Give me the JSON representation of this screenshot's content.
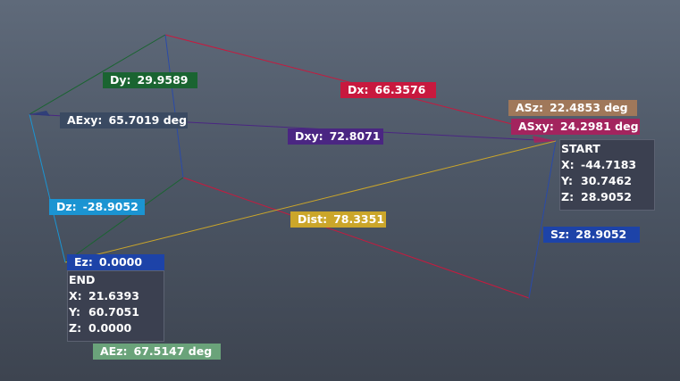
{
  "colors": {
    "background_top": "#5f6a7a",
    "background_bottom": "#3d4450",
    "dx": "#c8193e",
    "dy": "#1a6431",
    "dz": "#1b94d2",
    "dxy": "#4a2682",
    "dist": "#cba62a",
    "sz": "#1d43a8",
    "ez": "#1d43a8",
    "axy": "#3a4a62",
    "asz": "#a0785a",
    "asxy": "#a3245e",
    "aez": "#6aa37a",
    "panel": "#3b4050"
  },
  "measurements": {
    "dy": {
      "label": "Dy:",
      "value": "29.9589"
    },
    "dx": {
      "label": "Dx:",
      "value": "66.3576"
    },
    "aexy": {
      "label": "AExy:",
      "value": "65.7019  deg"
    },
    "dxy": {
      "label": "Dxy:",
      "value": "72.8071"
    },
    "asz": {
      "label": "ASz:",
      "value": "22.4853  deg"
    },
    "asxy": {
      "label": "ASxy:",
      "value": "24.2981  deg"
    },
    "dz": {
      "label": "Dz:",
      "value": "-28.9052"
    },
    "dist": {
      "label": "Dist:",
      "value": "78.3351"
    },
    "sz": {
      "label": "Sz:",
      "value": "28.9052"
    },
    "ez": {
      "label": "Ez:",
      "value": "0.0000"
    },
    "aez": {
      "label": "AEz:",
      "value": "67.5147  deg"
    }
  },
  "start_panel": {
    "title": "START",
    "x_label": "X:",
    "x_value": "-44.7183",
    "y_label": "Y:",
    "y_value": "30.7462",
    "z_label": "Z:",
    "z_value": "28.9052"
  },
  "end_panel": {
    "title": "END",
    "x_label": "X:",
    "x_value": "21.6393",
    "y_label": "Y:",
    "y_value": "60.7051",
    "z_label": "Z:",
    "z_value": "0.0000"
  }
}
